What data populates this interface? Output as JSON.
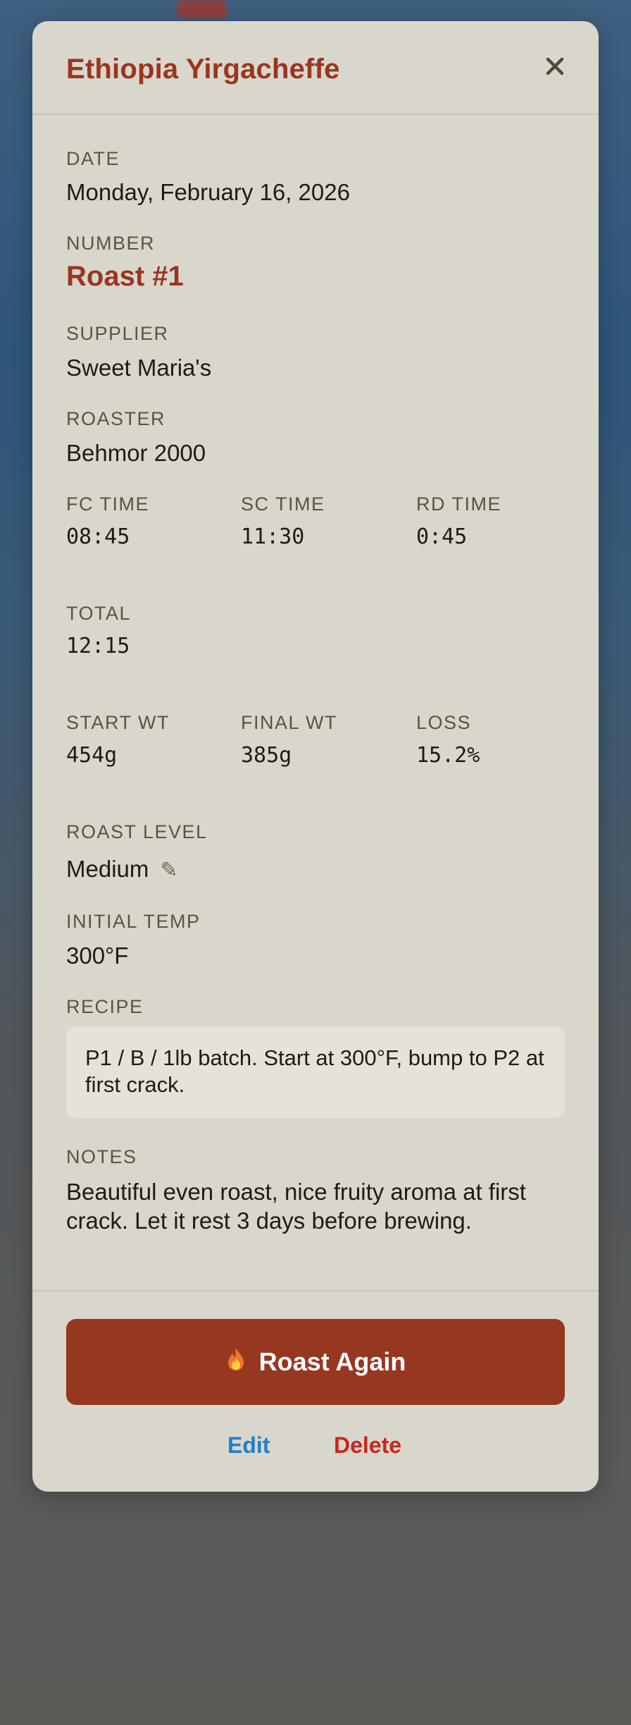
{
  "modal": {
    "title": "Ethiopia Yirgacheffe",
    "close_icon": "close-icon"
  },
  "fields": {
    "date_label": "DATE",
    "date_value": "Monday, February 16, 2026",
    "number_label": "NUMBER",
    "number_value": "Roast #1",
    "supplier_label": "SUPPLIER",
    "supplier_value": "Sweet Maria's",
    "roaster_label": "ROASTER",
    "roaster_value": "Behmor 2000",
    "fc_time_label": "FC TIME",
    "fc_time_value": "08:45",
    "sc_time_label": "SC TIME",
    "sc_time_value": "11:30",
    "rd_time_label": "RD TIME",
    "rd_time_value": "0:45",
    "total_label": "TOTAL",
    "total_value": "12:15",
    "start_wt_label": "START WT",
    "start_wt_value": "454g",
    "final_wt_label": "FINAL WT",
    "final_wt_value": "385g",
    "loss_label": "LOSS",
    "loss_value": "15.2%",
    "roast_level_label": "ROAST LEVEL",
    "roast_level_value": "Medium",
    "roast_level_edit_icon": "pencil-icon",
    "initial_temp_label": "INITIAL TEMP",
    "initial_temp_value": "300°F",
    "recipe_label": "RECIPE",
    "recipe_value": "P1 / B / 1lb batch. Start at 300°F, bump to P2 at first crack.",
    "notes_label": "NOTES",
    "notes_value": "Beautiful even roast, nice fruity aroma at first crack. Let it rest 3 days before brewing."
  },
  "actions": {
    "roast_again_icon": "flame-icon",
    "roast_again_label": "Roast Again",
    "edit_label": "Edit",
    "delete_label": "Delete"
  },
  "colors": {
    "accent": "#9a3520",
    "button": "#963820",
    "edit_link": "#1e80c8",
    "delete_link": "#c9261c",
    "modal_bg": "#d9d7cc"
  }
}
